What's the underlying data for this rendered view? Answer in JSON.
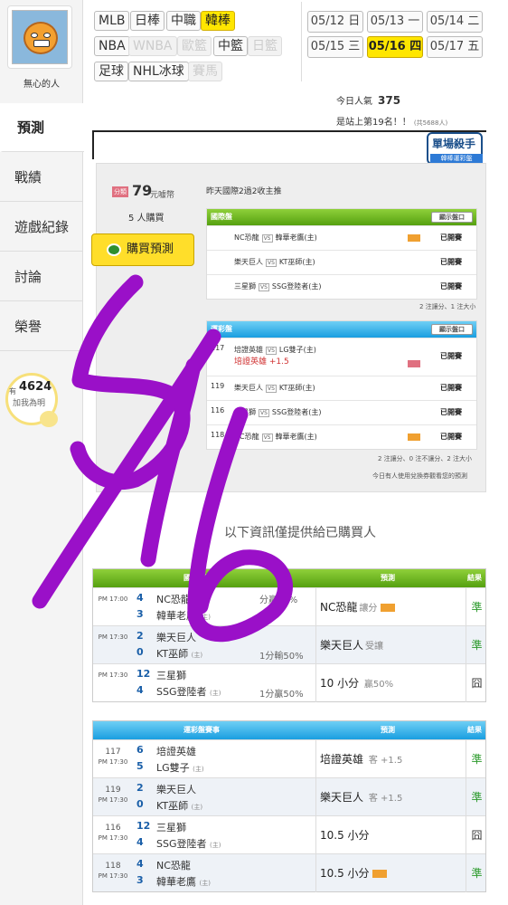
{
  "user": {
    "name": "無心的人"
  },
  "nav": {
    "items": [
      {
        "label": "預測"
      },
      {
        "label": "戰績"
      },
      {
        "label": "遊戲紀錄"
      },
      {
        "label": "討論"
      },
      {
        "label": "榮譽"
      }
    ]
  },
  "popularity": {
    "have": "有",
    "count": "4624",
    "sub": "加我為明"
  },
  "leagues": {
    "row1": [
      "MLB",
      "日棒",
      "中職",
      "韓棒"
    ],
    "row2": [
      "NBA",
      "WNBA",
      "歐籃",
      "中籃",
      "日籃"
    ],
    "row3": [
      "足球",
      "NHL冰球",
      "賽馬"
    ],
    "active": "韓棒",
    "disabled": [
      "WNBA",
      "歐籃",
      "日籃",
      "賽馬"
    ]
  },
  "dates": [
    "05/12 日",
    "05/13 一",
    "05/14 二",
    "05/15 三",
    "05/16 四",
    "05/17 五"
  ],
  "active_date": "05/16 四",
  "stats": {
    "pop_label": "今日人氣",
    "pop_value": "375",
    "rank_text": "是站上第19名！！",
    "rank_sub": "(共5688人)"
  },
  "badge": {
    "title": "單場殺手",
    "ribbon": "韓棒運彩盤"
  },
  "sale": {
    "tag": "分類",
    "price": "79",
    "unit": "元噱幣",
    "buyers": "5 人購買",
    "buy_label": "購買預測",
    "record": "昨天國際2過2收主推"
  },
  "intl": {
    "title": "國際盤",
    "show": "顯示盤口",
    "rows": [
      {
        "num": "",
        "home": "NC恐龍",
        "away": "韓華老鷹(主)",
        "status": "已開賽"
      },
      {
        "num": "",
        "home": "樂天巨人",
        "away": "KT巫師(主)",
        "status": "已開賽"
      },
      {
        "num": "",
        "home": "三星獅",
        "away": "SSG登陸者(主)",
        "status": "已開賽"
      }
    ],
    "note": "2 注讓分、1 注大小"
  },
  "sport": {
    "title": "運彩盤",
    "show": "顯示盤口",
    "rows": [
      {
        "num": "117",
        "home": "培證英雄",
        "away": "LG雙子(主)",
        "pick": "培證英雄 +1.5",
        "status": "已開賽"
      },
      {
        "num": "119",
        "home": "樂天巨人",
        "away": "KT巫師(主)",
        "pick": "",
        "status": "已開賽"
      },
      {
        "num": "116",
        "home": "三星獅",
        "away": "SSG登陸者(主)",
        "pick": "",
        "status": "已開賽"
      },
      {
        "num": "118",
        "home": "NC恐龍",
        "away": "韓華老鷹(主)",
        "pick": "",
        "status": "已開賽"
      }
    ],
    "note": "2 注讓分、0 注不讓分、2 注大小",
    "footer": "今日有人使用兌換券觀看您的預測"
  },
  "info_text": "以下資訊僅提供給已購買人",
  "result_intl": {
    "headers": {
      "game": "國際盤賽事",
      "pred": "預測",
      "res": "結果"
    },
    "rows": [
      {
        "num": "",
        "time": "PM 17:00",
        "s1": "4",
        "t1": "NC恐龍",
        "s2": "3",
        "t2": "韓華老鷹",
        "host": "(主)",
        "hint": "分贏50%",
        "pred": "NC恐龍",
        "pred_sub": "讓分",
        "res": "準",
        "ok": true
      },
      {
        "num": "",
        "time": "PM 17:30",
        "s1": "2",
        "t1": "樂天巨人",
        "s2": "0",
        "t2": "KT巫師",
        "host": "(主)",
        "hint": "1分輸50%",
        "pred": "樂天巨人",
        "pred_sub": "受讓",
        "res": "準",
        "ok": true
      },
      {
        "num": "",
        "time": "PM 17:30",
        "s1": "12",
        "t1": "三星獅",
        "s2": "4",
        "t2": "SSG登陸者",
        "host": "(主)",
        "hint": "1分贏50%",
        "pred": "10 小分",
        "pred_sub": "贏50%",
        "res": "囧",
        "ok": false
      }
    ]
  },
  "result_sport": {
    "headers": {
      "game": "運彩盤賽事",
      "pred": "預測",
      "res": "結果"
    },
    "rows": [
      {
        "num": "117",
        "time": "PM 17:30",
        "s1": "6",
        "t1": "培證英雄",
        "s2": "5",
        "t2": "LG雙子",
        "host": "(主)",
        "pred": "培證英雄",
        "pred_sub": "客 +1.5",
        "res": "準",
        "ok": true
      },
      {
        "num": "119",
        "time": "PM 17:30",
        "s1": "2",
        "t1": "樂天巨人",
        "s2": "0",
        "t2": "KT巫師",
        "host": "(主)",
        "pred": "樂天巨人",
        "pred_sub": "客 +1.5",
        "res": "準",
        "ok": true
      },
      {
        "num": "116",
        "time": "PM 17:30",
        "s1": "12",
        "t1": "三星獅",
        "s2": "4",
        "t2": "SSG登陸者",
        "host": "(主)",
        "pred": "10.5 小分",
        "pred_sub": "",
        "res": "囧",
        "ok": false
      },
      {
        "num": "118",
        "time": "PM 17:30",
        "s1": "4",
        "t1": "NC恐龍",
        "s2": "3",
        "t2": "韓華老鷹",
        "host": "(主)",
        "pred": "10.5 小分",
        "pred_sub": "",
        "res": "準",
        "ok": true
      }
    ]
  },
  "handwriting": "5/16",
  "colors": {
    "accent": "#ffe600",
    "green": "#55a010",
    "blue": "#1a9ee0",
    "ink": "#9a10c8"
  }
}
